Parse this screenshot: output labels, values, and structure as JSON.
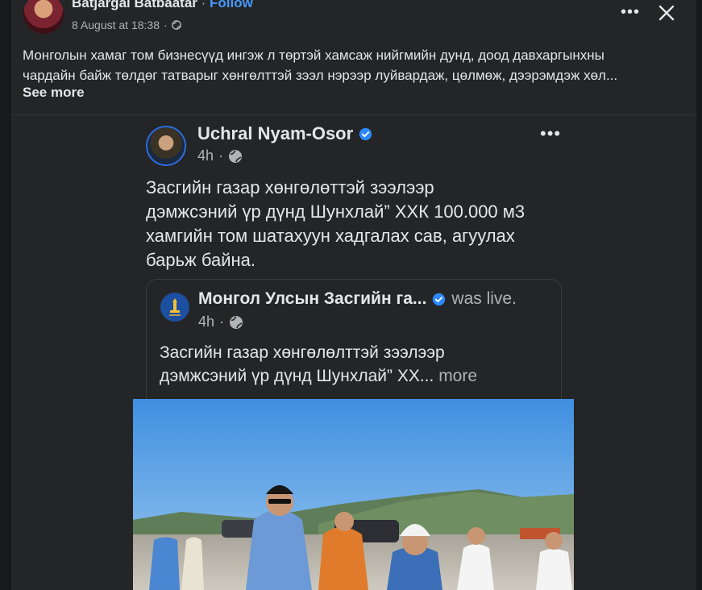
{
  "post": {
    "author": "Batjargal Batbaatar",
    "follow_label": "Follow",
    "separator": "·",
    "timestamp": "8 August at 18:38",
    "text_lines": [
      "Монголын хамаг том бизнесүүд ингэж л төртэй хамсаж нийгмийн дунд, доод давхаргынхны",
      "чардайн байж төлдөг татварыг хөнгөлттэй зээл нэрээр луйвардаж, цөлмөж, дээрэмдэж хөл..."
    ],
    "see_more": "See more"
  },
  "shared_screenshot": {
    "author": "Uchral Nyam-Osor",
    "time": "4h",
    "text_lines": [
      "Засгийн газар хөнгөлөттэй зээлээр",
      "дэмжсэний үр дүнд Шунхлай” ХХК 100.000 м3",
      "хамгийн том шатахуун хадгалах сав, агуулах",
      "барьж байна."
    ],
    "inner_post": {
      "author": "Монгол Улсын Засгийн га...",
      "status": "was live.",
      "time": "4h",
      "text_lines": [
        "Засгийн газар хөнгөлөлттэй зээлээр",
        "дэмжсэний үр дүнд Шунхлай” ХХ..."
      ],
      "more": "more"
    }
  },
  "colors": {
    "page_bg": "#18191a",
    "card_bg": "#242526",
    "link": "#4599ff",
    "verified": "#2d88ff"
  }
}
